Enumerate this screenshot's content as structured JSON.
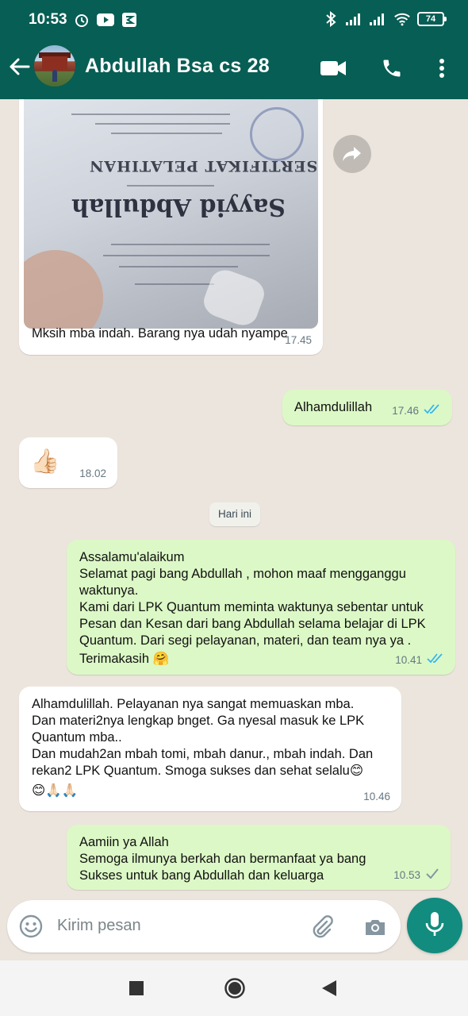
{
  "status_bar": {
    "time": "10:53",
    "battery": "74",
    "left_icons": [
      "alarm-icon",
      "youtube-icon",
      "app-notification-icon"
    ],
    "right_icons": [
      "bluetooth-icon",
      "signal-icon",
      "signal-icon",
      "wifi-icon",
      "battery-icon"
    ]
  },
  "header": {
    "contact_name": "Abdullah Bsa cs 28",
    "icons": [
      "back-arrow-icon",
      "avatar",
      "video-call-icon",
      "phone-icon",
      "more-options-icon"
    ],
    "color": "#075e54"
  },
  "messages": [
    {
      "type": "incoming",
      "has_image": true,
      "text": "Mksih mba indah. Barang nya udah nyampe",
      "time": "17.45"
    },
    {
      "type": "outgoing",
      "text": "Alhamdulillah",
      "time": "17.46",
      "status": "read"
    },
    {
      "type": "incoming",
      "emoji": "👍🏻",
      "time": "18.02"
    },
    {
      "type": "date",
      "text": "Hari ini"
    },
    {
      "type": "outgoing",
      "lines": [
        "Assalamu'alaikum",
        "Selamat pagi bang Abdullah , mohon maaf mengganggu",
        "waktunya.",
        "Kami dari LPK Quantum meminta waktunya sebentar untuk",
        "Pesan dan Kesan dari bang Abdullah selama belajar di LPK",
        "Quantum. Dari segi pelayanan, materi, dan team nya ya .",
        "Terimakasih 🤗"
      ],
      "time": "10.41",
      "status": "read"
    },
    {
      "type": "incoming",
      "lines": [
        "Alhamdulillah. Pelayanan nya sangat memuaskan mba.",
        "Dan materi2nya lengkap bnget. Ga nyesal masuk ke LPK",
        "Quantum mba..",
        "Dan mudah2an mbah tomi, mbah danur., mbah indah. Dan",
        "rekan2 LPK Quantum. Smoga sukses dan sehat selalu😊",
        "😊🙏🏻🙏🏻"
      ],
      "time": "10.46"
    },
    {
      "type": "outgoing",
      "lines": [
        "Aamiin ya Allah",
        "Semoga ilmunya berkah dan bermanfaat ya bang",
        "Sukses untuk bang Abdullah dan keluarga"
      ],
      "time": "10.53",
      "status": "sent"
    }
  ],
  "image_text": {
    "cert_title": "SERTIFIKAT PELATIHAN",
    "cert_name": "Sayyid Abdullah"
  },
  "input": {
    "placeholder": "Kirim pesan",
    "icons": [
      "emoji-icon",
      "attach-icon",
      "camera-icon",
      "mic-icon"
    ]
  },
  "nav": {
    "icons": [
      "recent-apps-icon",
      "home-icon",
      "back-icon"
    ]
  },
  "colors": {
    "outgoing_bubble": "#dcf8c6",
    "incoming_bubble": "#ffffff",
    "read_ticks": "#34b7f1",
    "mic_button": "#128c7e"
  }
}
